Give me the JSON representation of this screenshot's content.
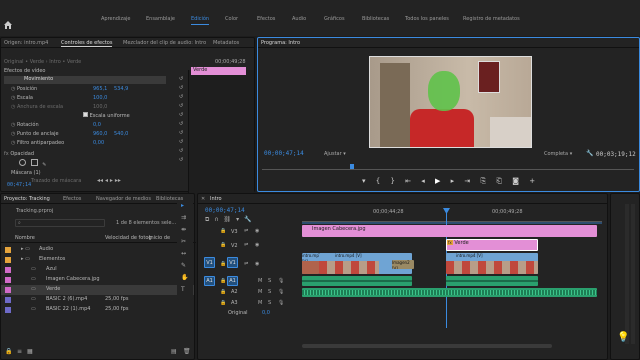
{
  "workspace_tabs": [
    "Aprendizaje",
    "Ensamblaje",
    "Edición",
    "Color",
    "Efectos",
    "Audio",
    "Gráficos",
    "Bibliotecas",
    "Todos los paneles",
    "Registro de metadatos"
  ],
  "active_workspace": "Edición",
  "left_tabs": {
    "origin": "Origen: intro.mp4",
    "effects": "Controles de efectos",
    "mixer": "Mezclador del clip de audio: Intro",
    "metadata": "Metadatos"
  },
  "effect_controls": {
    "header": "Original • Verde  ›  Intro • Verde",
    "clip_label": "Verde",
    "time": "00;00;49;28",
    "section": "Efectos de vídeo",
    "motion": "Movimiento",
    "position_label": "Posición",
    "position_x": "965,1",
    "position_y": "534,9",
    "scale_label": "Escala",
    "scale": "100,0",
    "scale_width_label": "Anchura de escala",
    "scale_width": "100,0",
    "uniform_label": "Escala uniforme",
    "rotation_label": "Rotación",
    "rotation": "0,0",
    "anchor_label": "Punto de anclaje",
    "anchor_x": "960,0",
    "anchor_y": "540,0",
    "flicker_label": "Filtro antiparpadeo",
    "flicker": "0,00",
    "opacity_label": "Opacidad",
    "mask_label": "Máscara (1)",
    "mask_path_label": "Trazado de máscara",
    "timecode": "00;47;14"
  },
  "program": {
    "title": "Programa: Intro",
    "timecode": "00;00;47;14",
    "fit": "Ajustar",
    "quality": "Completa",
    "duration": "00;03;19;12"
  },
  "project": {
    "tabs": [
      "Proyecto: Tracking",
      "Efectos",
      "Navegador de medios",
      "Bibliotecas"
    ],
    "file": "Tracking.prproj",
    "count": "1 de 8 elementos sele...",
    "col_name": "Nombre",
    "col_fps": "Velocidad de fotog",
    "col_start": "Inicio de",
    "items": [
      {
        "name": "Audio",
        "type": "folder",
        "color": "#e5a43c",
        "fps": ""
      },
      {
        "name": "Elementos",
        "type": "folder",
        "color": "#e5a43c",
        "fps": ""
      },
      {
        "name": "Azul",
        "type": "item",
        "color": "#d06ac8",
        "fps": ""
      },
      {
        "name": "Imagen Cabecera.jpg",
        "type": "item",
        "color": "#d06ac8",
        "fps": ""
      },
      {
        "name": "Verde",
        "type": "item",
        "color": "#d06ac8",
        "fps": ""
      },
      {
        "name": "BASIC 2 (6).mp4",
        "type": "item",
        "color": "#6e6ac8",
        "fps": "25,00 fps"
      },
      {
        "name": "BASIC 22 (1).mp4",
        "type": "item",
        "color": "#6e6ac8",
        "fps": "25,00 fps"
      }
    ]
  },
  "timeline": {
    "title": "Intro",
    "timecode": "00;00;47;14",
    "ruler": [
      "00;00;44;28",
      "00;00;49;28"
    ],
    "tracks_video": [
      "V3",
      "V2",
      "V1"
    ],
    "tracks_audio": [
      "A1",
      "A2",
      "A3"
    ],
    "source_v": "V1",
    "source_a": "A1",
    "master_label": "Original",
    "master_value": "0,0",
    "clips": {
      "v3": "Imagen Cabecera.jpg",
      "v2": "Verde",
      "v1a": "intro.mp4 [V]",
      "v1b": "intro.mp4 [V]",
      "v1c": "Imagen2 [V]",
      "v1d": "intro.mp4 [V]"
    }
  },
  "colors": {
    "accent": "#3b8be0",
    "pink": "#e38fd6",
    "video_clip": "#6fa4d4",
    "audio_clip": "#2aa06e"
  }
}
